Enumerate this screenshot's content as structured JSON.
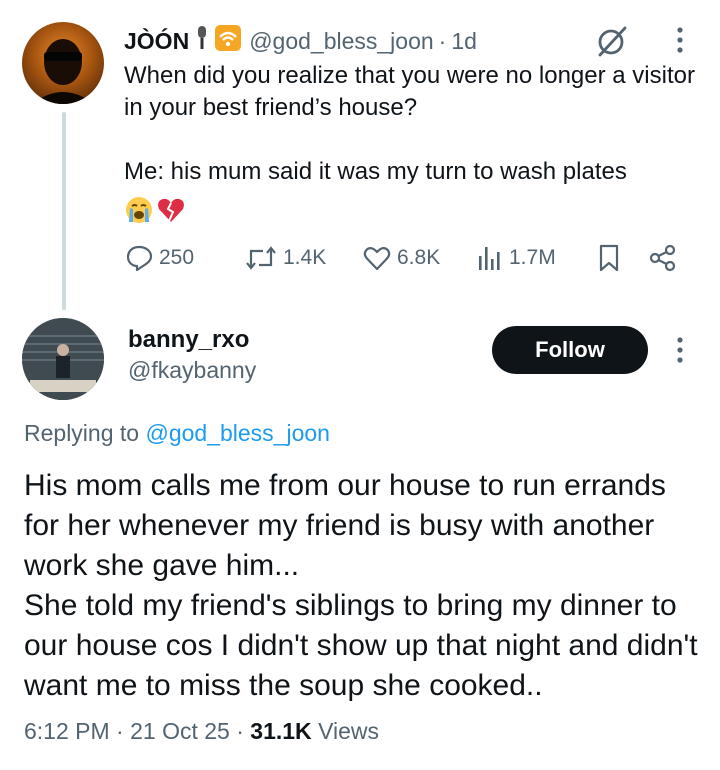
{
  "parent_tweet": {
    "display_name": "JÒÓN",
    "name_emojis": [
      "microphone-emoji",
      "wifi-emoji"
    ],
    "handle": "@god_bless_joon",
    "separator": "·",
    "time": "1d",
    "text": "When did you realize that you were no longer a visitor in your best friend’s house?\n\nMe: his mum said it was my turn to wash plates",
    "emojis": [
      "loudly-crying-face-emoji",
      "broken-heart-emoji"
    ],
    "actions": {
      "replies": "250",
      "reposts": "1.4K",
      "likes": "6.8K",
      "views": "1.7M"
    }
  },
  "reply": {
    "display_name": "banny_rxo",
    "handle": "@fkaybanny",
    "follow_label": "Follow",
    "replying_prefix": "Replying to",
    "replying_to": "@god_bless_joon",
    "text": "His mom calls me from our house to run errands for her whenever my friend is busy with another work she gave him...\nShe told my friend's siblings to bring my dinner to our house cos I didn't show up that night and didn't want me to miss the soup she cooked..",
    "time": "6:12 PM",
    "date": "21 Oct 25",
    "separator": "·",
    "views_count": "31.1K",
    "views_label": "Views"
  },
  "colors": {
    "text_primary": "#0f1419",
    "text_secondary": "#536471",
    "link": "#1d9bf0",
    "thread_line": "#cfd9de",
    "follow_button_bg": "#0f1419",
    "wifi_emoji": "#f5a623"
  }
}
